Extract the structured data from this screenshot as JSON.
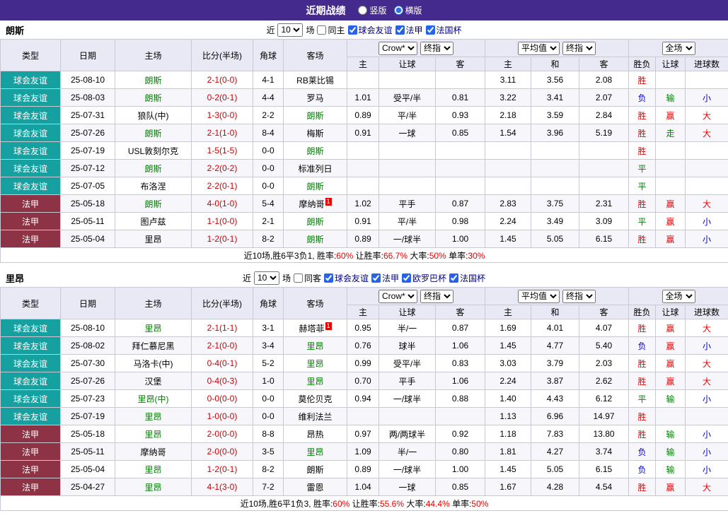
{
  "header": {
    "title": "近期战绩",
    "options": [
      {
        "label": "竖版",
        "selected": false
      },
      {
        "label": "横版",
        "selected": true
      }
    ]
  },
  "columns": {
    "type": "类型",
    "date": "日期",
    "home": "主场",
    "score": "比分(半场)",
    "corner": "角球",
    "away": "客场",
    "odds_home": "主",
    "odds_line": "让球",
    "odds_away": "客",
    "avg_home": "主",
    "avg_draw": "和",
    "avg_away": "客",
    "result": "胜负",
    "handicap": "让球",
    "goals": "进球数"
  },
  "colors": {
    "topbar_bg": "#452a8e",
    "friendly_bg": "#16a0a0",
    "ligue1_bg": "#8e3246",
    "team_green": "#008000",
    "score_red": "#cc0000",
    "win_red": "#e60000",
    "draw_green": "#008000",
    "lose_blue": "#0000cc",
    "big_red": "#e60000",
    "small_blue": "#0000cc",
    "league_label_blue": "#000080",
    "summary_red": "#e60000",
    "header_row_bg": "#e9e9f5",
    "badge_red": "#e60000"
  },
  "sections": [
    {
      "team": "朗斯",
      "filter": {
        "prefix": "近",
        "count": "10",
        "suffix": "场",
        "checkboxes": [
          {
            "label": "同主",
            "checked": false,
            "league": false
          },
          {
            "label": "球会友谊",
            "checked": true,
            "league": true
          },
          {
            "label": "法甲",
            "checked": true,
            "league": true
          },
          {
            "label": "法国杯",
            "checked": true,
            "league": true
          }
        ]
      },
      "selectors": {
        "odds_source": "Crow*",
        "odds_kind": "终指",
        "avg_source": "平均值",
        "avg_kind": "终指",
        "scope": "全场"
      },
      "rows": [
        {
          "type": "球会友谊",
          "tk": "friendly",
          "date": "25-08-10",
          "home": "朗斯",
          "home_self": true,
          "score": "2-1(0-0)",
          "corner": "4-1",
          "away": "RB莱比锡",
          "away_self": false,
          "o1": "",
          "line": "",
          "o2": "",
          "e1": "3.11",
          "e2": "3.56",
          "e3": "2.08",
          "res": "胜",
          "han": "",
          "goal": ""
        },
        {
          "type": "球会友谊",
          "tk": "friendly",
          "date": "25-08-03",
          "home": "朗斯",
          "home_self": true,
          "score": "0-2(0-1)",
          "corner": "4-4",
          "away": "罗马",
          "away_self": false,
          "o1": "1.01",
          "line": "受平/半",
          "o2": "0.81",
          "e1": "3.22",
          "e2": "3.41",
          "e3": "2.07",
          "res": "负",
          "han": "输",
          "goal": "小"
        },
        {
          "type": "球会友谊",
          "tk": "friendly",
          "date": "25-07-31",
          "home": "狼队(中)",
          "home_self": false,
          "score": "1-3(0-0)",
          "corner": "2-2",
          "away": "朗斯",
          "away_self": true,
          "o1": "0.89",
          "line": "平/半",
          "o2": "0.93",
          "e1": "2.18",
          "e2": "3.59",
          "e3": "2.84",
          "res": "胜",
          "han": "赢",
          "goal": "大"
        },
        {
          "type": "球会友谊",
          "tk": "friendly",
          "date": "25-07-26",
          "home": "朗斯",
          "home_self": true,
          "score": "2-1(1-0)",
          "corner": "8-4",
          "away": "梅斯",
          "away_self": false,
          "o1": "0.91",
          "line": "一球",
          "o2": "0.85",
          "e1": "1.54",
          "e2": "3.96",
          "e3": "5.19",
          "res": "胜",
          "han": "走",
          "goal": "大"
        },
        {
          "type": "球会友谊",
          "tk": "friendly",
          "date": "25-07-19",
          "home": "USL敦刻尔克",
          "home_self": false,
          "score": "1-5(1-5)",
          "corner": "0-0",
          "away": "朗斯",
          "away_self": true,
          "o1": "",
          "line": "",
          "o2": "",
          "e1": "",
          "e2": "",
          "e3": "",
          "res": "胜",
          "han": "",
          "goal": ""
        },
        {
          "type": "球会友谊",
          "tk": "friendly",
          "date": "25-07-12",
          "home": "朗斯",
          "home_self": true,
          "score": "2-2(0-2)",
          "corner": "0-0",
          "away": "标准列日",
          "away_self": false,
          "o1": "",
          "line": "",
          "o2": "",
          "e1": "",
          "e2": "",
          "e3": "",
          "res": "平",
          "han": "",
          "goal": ""
        },
        {
          "type": "球会友谊",
          "tk": "friendly",
          "date": "25-07-05",
          "home": "布洛涅",
          "home_self": false,
          "score": "2-2(0-1)",
          "corner": "0-0",
          "away": "朗斯",
          "away_self": true,
          "o1": "",
          "line": "",
          "o2": "",
          "e1": "",
          "e2": "",
          "e3": "",
          "res": "平",
          "han": "",
          "goal": ""
        },
        {
          "type": "法甲",
          "tk": "ligue1",
          "date": "25-05-18",
          "home": "朗斯",
          "home_self": true,
          "score": "4-0(1-0)",
          "corner": "5-4",
          "away": "摩纳哥",
          "away_self": false,
          "away_mark": "1",
          "o1": "1.02",
          "line": "平手",
          "o2": "0.87",
          "e1": "2.83",
          "e2": "3.75",
          "e3": "2.31",
          "res": "胜",
          "han": "赢",
          "goal": "大"
        },
        {
          "type": "法甲",
          "tk": "ligue1",
          "date": "25-05-11",
          "home": "图卢兹",
          "home_self": false,
          "score": "1-1(0-0)",
          "corner": "2-1",
          "away": "朗斯",
          "away_self": true,
          "o1": "0.91",
          "line": "平/半",
          "o2": "0.98",
          "e1": "2.24",
          "e2": "3.49",
          "e3": "3.09",
          "res": "平",
          "han": "赢",
          "goal": "小"
        },
        {
          "type": "法甲",
          "tk": "ligue1",
          "date": "25-05-04",
          "home": "里昂",
          "home_self": false,
          "score": "1-2(0-1)",
          "corner": "8-2",
          "away": "朗斯",
          "away_self": true,
          "o1": "0.89",
          "line": "一/球半",
          "o2": "1.00",
          "e1": "1.45",
          "e2": "5.05",
          "e3": "6.15",
          "res": "胜",
          "han": "赢",
          "goal": "小"
        }
      ],
      "summary": [
        {
          "text": "近10场,胜6平3负1, 胜率:",
          "red": false
        },
        {
          "text": "60%",
          "red": true
        },
        {
          "text": " 让胜率:",
          "red": false
        },
        {
          "text": "66.7%",
          "red": true
        },
        {
          "text": " 大率:",
          "red": false
        },
        {
          "text": "50%",
          "red": true
        },
        {
          "text": " 单率:",
          "red": false
        },
        {
          "text": "30%",
          "red": true
        }
      ]
    },
    {
      "team": "里昂",
      "filter": {
        "prefix": "近",
        "count": "10",
        "suffix": "场",
        "checkboxes": [
          {
            "label": "同客",
            "checked": false,
            "league": false
          },
          {
            "label": "球会友谊",
            "checked": true,
            "league": true
          },
          {
            "label": "法甲",
            "checked": true,
            "league": true
          },
          {
            "label": "欧罗巴杯",
            "checked": true,
            "league": true
          },
          {
            "label": "法国杯",
            "checked": true,
            "league": true
          }
        ]
      },
      "selectors": {
        "odds_source": "Crow*",
        "odds_kind": "终指",
        "avg_source": "平均值",
        "avg_kind": "终指",
        "scope": "全场"
      },
      "rows": [
        {
          "type": "球会友谊",
          "tk": "friendly",
          "date": "25-08-10",
          "home": "里昂",
          "home_self": true,
          "score": "2-1(1-1)",
          "corner": "3-1",
          "away": "赫塔菲",
          "away_self": false,
          "away_mark": "1",
          "o1": "0.95",
          "line": "半/一",
          "o2": "0.87",
          "e1": "1.69",
          "e2": "4.01",
          "e3": "4.07",
          "res": "胜",
          "han": "赢",
          "goal": "大"
        },
        {
          "type": "球会友谊",
          "tk": "friendly",
          "date": "25-08-02",
          "home": "拜仁慕尼黑",
          "home_self": false,
          "score": "2-1(0-0)",
          "corner": "3-4",
          "away": "里昂",
          "away_self": true,
          "o1": "0.76",
          "line": "球半",
          "o2": "1.06",
          "e1": "1.45",
          "e2": "4.77",
          "e3": "5.40",
          "res": "负",
          "han": "赢",
          "goal": "小"
        },
        {
          "type": "球会友谊",
          "tk": "friendly",
          "date": "25-07-30",
          "home": "马洛卡(中)",
          "home_self": false,
          "score": "0-4(0-1)",
          "corner": "5-2",
          "away": "里昂",
          "away_self": true,
          "o1": "0.99",
          "line": "受平/半",
          "o2": "0.83",
          "e1": "3.03",
          "e2": "3.79",
          "e3": "2.03",
          "res": "胜",
          "han": "赢",
          "goal": "大"
        },
        {
          "type": "球会友谊",
          "tk": "friendly",
          "date": "25-07-26",
          "home": "汉堡",
          "home_self": false,
          "score": "0-4(0-3)",
          "corner": "1-0",
          "away": "里昂",
          "away_self": true,
          "o1": "0.70",
          "line": "平手",
          "o2": "1.06",
          "e1": "2.24",
          "e2": "3.87",
          "e3": "2.62",
          "res": "胜",
          "han": "赢",
          "goal": "大"
        },
        {
          "type": "球会友谊",
          "tk": "friendly",
          "date": "25-07-23",
          "home": "里昂(中)",
          "home_self": true,
          "score": "0-0(0-0)",
          "corner": "0-0",
          "away": "莫伦贝克",
          "away_self": false,
          "o1": "0.94",
          "line": "一/球半",
          "o2": "0.88",
          "e1": "1.40",
          "e2": "4.43",
          "e3": "6.12",
          "res": "平",
          "han": "输",
          "goal": "小"
        },
        {
          "type": "球会友谊",
          "tk": "friendly",
          "date": "25-07-19",
          "home": "里昂",
          "home_self": true,
          "score": "1-0(0-0)",
          "corner": "0-0",
          "away": "维利法兰",
          "away_self": false,
          "o1": "",
          "line": "",
          "o2": "",
          "e1": "1.13",
          "e2": "6.96",
          "e3": "14.97",
          "res": "胜",
          "han": "",
          "goal": ""
        },
        {
          "type": "法甲",
          "tk": "ligue1",
          "date": "25-05-18",
          "home": "里昂",
          "home_self": true,
          "score": "2-0(0-0)",
          "corner": "8-8",
          "away": "昂热",
          "away_self": false,
          "o1": "0.97",
          "line": "两/两球半",
          "o2": "0.92",
          "e1": "1.18",
          "e2": "7.83",
          "e3": "13.80",
          "res": "胜",
          "han": "输",
          "goal": "小"
        },
        {
          "type": "法甲",
          "tk": "ligue1",
          "date": "25-05-11",
          "home": "摩纳哥",
          "home_self": false,
          "score": "2-0(0-0)",
          "corner": "3-5",
          "away": "里昂",
          "away_self": true,
          "o1": "1.09",
          "line": "半/一",
          "o2": "0.80",
          "e1": "1.81",
          "e2": "4.27",
          "e3": "3.74",
          "res": "负",
          "han": "输",
          "goal": "小"
        },
        {
          "type": "法甲",
          "tk": "ligue1",
          "date": "25-05-04",
          "home": "里昂",
          "home_self": true,
          "score": "1-2(0-1)",
          "corner": "8-2",
          "away": "朗斯",
          "away_self": false,
          "o1": "0.89",
          "line": "一/球半",
          "o2": "1.00",
          "e1": "1.45",
          "e2": "5.05",
          "e3": "6.15",
          "res": "负",
          "han": "输",
          "goal": "小"
        },
        {
          "type": "法甲",
          "tk": "ligue1",
          "date": "25-04-27",
          "home": "里昂",
          "home_self": true,
          "score": "4-1(3-0)",
          "corner": "7-2",
          "away": "雷恩",
          "away_self": false,
          "o1": "1.04",
          "line": "一球",
          "o2": "0.85",
          "e1": "1.67",
          "e2": "4.28",
          "e3": "4.54",
          "res": "胜",
          "han": "赢",
          "goal": "大"
        }
      ],
      "summary": [
        {
          "text": "近10场,胜6平1负3, 胜率:",
          "red": false
        },
        {
          "text": "60%",
          "red": true
        },
        {
          "text": " 让胜率:",
          "red": false
        },
        {
          "text": "55.6%",
          "red": true
        },
        {
          "text": " 大率:",
          "red": false
        },
        {
          "text": "44.4%",
          "red": true
        },
        {
          "text": " 单率:",
          "red": false
        },
        {
          "text": "50%",
          "red": true
        }
      ]
    }
  ]
}
